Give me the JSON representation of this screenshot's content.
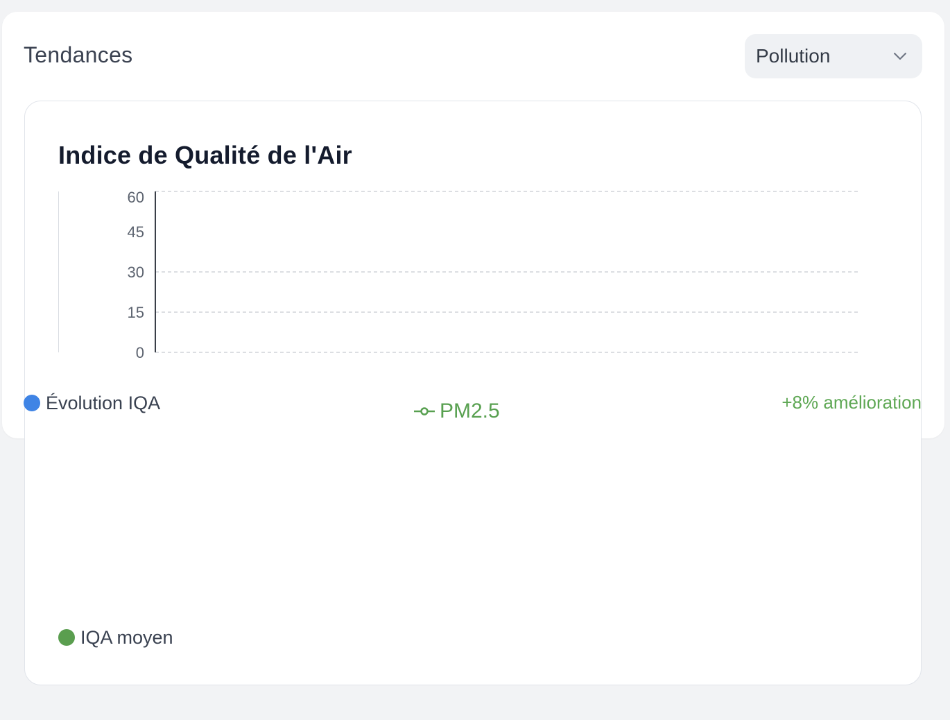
{
  "section": {
    "title": "Tendances"
  },
  "filter": {
    "selected": "Pollution",
    "icon": "chevron-down-icon"
  },
  "chart_data": {
    "type": "line",
    "title": "Indice de Qualité de l'Air",
    "xlabel": "",
    "ylabel": "",
    "ylim": [
      0,
      60
    ],
    "y_ticks": [
      "60",
      "45",
      "30",
      "15",
      "0"
    ],
    "grid": true,
    "series": [
      {
        "name": "PM2.5",
        "color": "#58a050",
        "values": []
      }
    ]
  },
  "legend": {
    "evolution": {
      "label": "Évolution IQA",
      "color": "#3f84e5"
    },
    "average": {
      "label": "IQA moyen",
      "color": "#5a9e4f"
    }
  },
  "improvement": {
    "text": "+8% amélioration"
  },
  "colors": {
    "accent_blue": "#3f84e5",
    "accent_green": "#58a050",
    "background": "#f2f3f5"
  }
}
